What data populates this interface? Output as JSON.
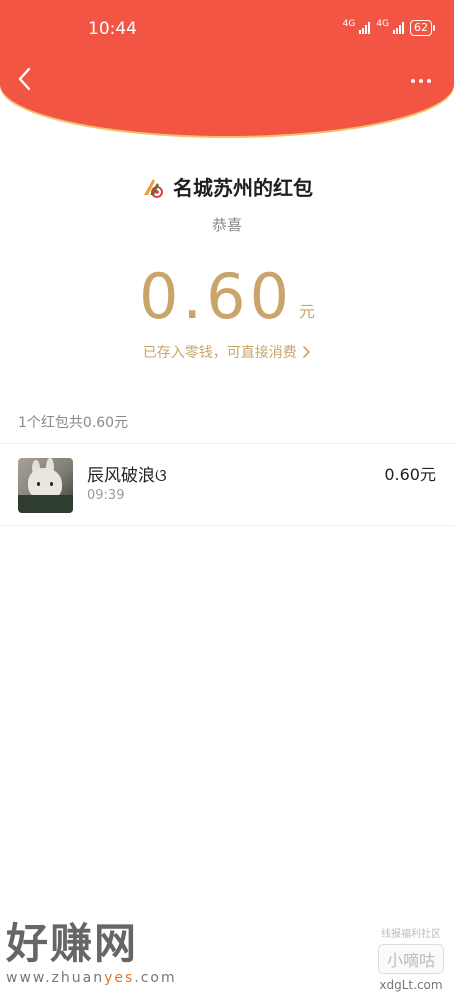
{
  "status_bar": {
    "time": "10:44",
    "network_1": "4G",
    "network_2": "4G",
    "battery": "62"
  },
  "header": {
    "back_icon": "chevron-left-icon",
    "more_icon": "more-dots-icon",
    "color": "#f25543"
  },
  "envelope": {
    "sender_title": "名城苏州的红包",
    "blessing": "恭喜",
    "amount": "0.60",
    "unit": "元",
    "saved_link": "已存入零钱，可直接消费",
    "accent_color": "#c9a56a"
  },
  "summary": "1个红包共0.60元",
  "records": [
    {
      "name": "辰风破浪ଓ",
      "time": "09:39",
      "amount": "0.60元"
    }
  ],
  "watermarks": {
    "left_big": "好赚网",
    "left_url_prefix": "www.zhuan",
    "left_url_highlight": "yes",
    "left_url_suffix": ".com",
    "right_top": "线报福利社区",
    "right_box": "小嘀咕",
    "right_url": "xdgLt.com"
  }
}
